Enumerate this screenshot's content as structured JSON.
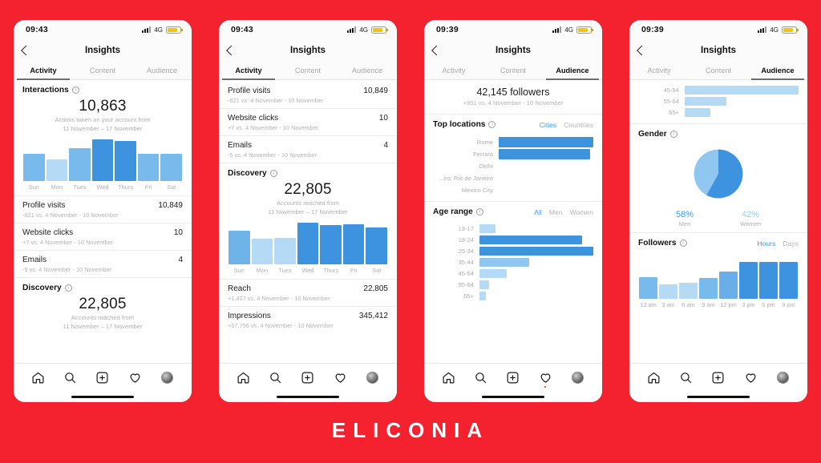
{
  "brand": {
    "name": "ELICONIA"
  },
  "theme": {
    "background_red": "#F4212E",
    "accent_blue": "#3D9BE9",
    "bar_dark": "#3E93DE",
    "bar_mid": "#79BAEC",
    "bar_light": "#B5DAF5"
  },
  "nav": {
    "title": "Insights",
    "back_icon": "chevron-left-icon"
  },
  "tabs": {
    "activity": "Activity",
    "content": "Content",
    "audience": "Audience"
  },
  "bottom_nav": {
    "home": "home-icon",
    "search": "search-icon",
    "create": "plus-square-icon",
    "activity": "heart-icon",
    "profile": "avatar-icon"
  },
  "phones": [
    {
      "id": "phone-1",
      "status": {
        "time": "09:43",
        "network": "4G",
        "signal_icon": "signal-bars-icon",
        "battery_icon": "battery-low-power-icon"
      },
      "active_tab": "Activity",
      "sections": {
        "interactions": {
          "title": "Interactions",
          "value": "10,863",
          "subtitle_line1": "Actions taken on your account from",
          "subtitle_line2": "11 November – 17 November"
        },
        "discovery": {
          "title": "Discovery",
          "value": "22,805",
          "subtitle_line1": "Accounts reached from",
          "subtitle_line2": "11 November – 17 November"
        }
      },
      "metrics": [
        {
          "label": "Profile visits",
          "value": "10,849",
          "sub": "-621 vs. 4 November - 10 November"
        },
        {
          "label": "Website clicks",
          "value": "10",
          "sub": "+7 vs. 4 November - 10 November"
        },
        {
          "label": "Emails",
          "value": "4",
          "sub": "-5 vs. 4 November - 10 November"
        }
      ]
    },
    {
      "id": "phone-2",
      "status": {
        "time": "09:43",
        "network": "4G",
        "signal_icon": "signal-bars-icon",
        "battery_icon": "battery-low-power-icon"
      },
      "active_tab": "Activity",
      "metrics_top": [
        {
          "label": "Profile visits",
          "value": "10,849",
          "sub": "-621 vs. 4 November - 10 November"
        },
        {
          "label": "Website clicks",
          "value": "10",
          "sub": "+7 vs. 4 November - 10 November"
        },
        {
          "label": "Emails",
          "value": "4",
          "sub": "-5 vs. 4 November - 10 November"
        }
      ],
      "sections": {
        "discovery": {
          "title": "Discovery",
          "value": "22,805",
          "subtitle_line1": "Accounts reached from",
          "subtitle_line2": "11 November – 17 November"
        }
      },
      "metrics_bottom": [
        {
          "label": "Reach",
          "value": "22,805",
          "sub": "+1,427 vs. 4 November - 10 November"
        },
        {
          "label": "Impressions",
          "value": "345,412",
          "sub": "+57,756 vs. 4 November - 10 November"
        }
      ]
    },
    {
      "id": "phone-3",
      "status": {
        "time": "09:39",
        "network": "4G",
        "signal_icon": "signal-bars-icon",
        "battery_icon": "battery-low-power-icon"
      },
      "active_tab": "Audience",
      "followers": {
        "count": "42,145 followers",
        "sub": "+801 vs. 4 November - 10 November"
      },
      "top_locations": {
        "title": "Top locations",
        "seg_on": "Cities",
        "seg_off": "Countries"
      },
      "age_range": {
        "title": "Age range",
        "seg_all": "All",
        "seg_men": "Men",
        "seg_women": "Women"
      }
    },
    {
      "id": "phone-4",
      "status": {
        "time": "09:39",
        "network": "4G",
        "signal_icon": "signal-bars-icon",
        "battery_icon": "battery-low-power-icon"
      },
      "active_tab": "Audience",
      "gender": {
        "title": "Gender",
        "men_pct": "58%",
        "men_label": "Men",
        "women_pct": "42%",
        "women_label": "Women"
      },
      "followers_chart": {
        "title": "Followers",
        "seg_on": "Hours",
        "seg_off": "Days"
      }
    }
  ],
  "chart_data": [
    {
      "type": "bar",
      "id": "interactions-weekday-bars",
      "title": "Interactions",
      "categories": [
        "Sun",
        "Mon",
        "Tues",
        "Wed",
        "Thurs",
        "Fri",
        "Sat"
      ],
      "values": [
        66,
        52,
        78,
        100,
        96,
        66,
        66
      ],
      "colors": [
        "#79BAEC",
        "#B5DAF5",
        "#79BAEC",
        "#3E93DE",
        "#3E93DE",
        "#79BAEC",
        "#79BAEC"
      ],
      "ylabel": "Interactions",
      "xlabel": "",
      "grid": false
    },
    {
      "type": "bar",
      "id": "discovery-weekday-bars",
      "title": "Discovery",
      "categories": [
        "Sun",
        "Mon",
        "Tues",
        "Wed",
        "Thurs",
        "Fri",
        "Sat"
      ],
      "values": [
        80,
        62,
        64,
        100,
        94,
        96,
        88
      ],
      "colors": [
        "#6FB4E8",
        "#B5DAF5",
        "#B5DAF5",
        "#3E93DE",
        "#3E93DE",
        "#3E93DE",
        "#3E93DE"
      ],
      "ylabel": "Discovery",
      "xlabel": "",
      "grid": false
    },
    {
      "type": "bar",
      "id": "top-locations-bars",
      "title": "Top locations",
      "orientation": "horizontal",
      "categories": [
        "Rome",
        "Ferrara",
        "Delhi",
        "...iro, Rio de Janeiro",
        "Mexico City"
      ],
      "values": [
        100,
        97,
        0,
        0,
        0
      ],
      "colors": [
        "#3E93DE",
        "#3E93DE",
        "#3E93DE",
        "#3E93DE",
        "#3E93DE"
      ],
      "grid": false
    },
    {
      "type": "bar",
      "id": "age-range-bars",
      "title": "Age range",
      "orientation": "horizontal",
      "categories": [
        "13-17",
        "18-24",
        "25-34",
        "35-44",
        "45-54",
        "55-64",
        "65+"
      ],
      "values": [
        13,
        82,
        91,
        40,
        22,
        8,
        5
      ],
      "colors": [
        "#B5DAF5",
        "#3E93DE",
        "#3E93DE",
        "#8FC7F0",
        "#B5DAF5",
        "#B5DAF5",
        "#B5DAF5"
      ],
      "grid": false
    },
    {
      "type": "bar",
      "id": "age-range-bars-continued",
      "title": "Age range (continued)",
      "orientation": "horizontal",
      "categories": [
        "45-54",
        "55-64",
        "65+"
      ],
      "values": [
        22,
        8,
        5
      ],
      "colors": [
        "#B5DAF5",
        "#B5DAF5",
        "#B5DAF5"
      ],
      "grid": false
    },
    {
      "type": "pie",
      "id": "gender-pie",
      "title": "Gender",
      "labels": [
        "Men",
        "Women"
      ],
      "values": [
        58,
        42
      ],
      "colors": [
        "#3E93DE",
        "#8FC7F0"
      ],
      "legend": "bottom"
    },
    {
      "type": "bar",
      "id": "followers-hours-bars",
      "title": "Followers",
      "categories": [
        "12 am",
        "3 am",
        "6 am",
        "9 am",
        "12 pm",
        "3 pm",
        "6 pm",
        "9 pm"
      ],
      "values": [
        50,
        34,
        38,
        48,
        64,
        86,
        86,
        86
      ],
      "colors": [
        "#79BAEC",
        "#B5DAF5",
        "#B5DAF5",
        "#79BAEC",
        "#68AEE8",
        "#3E93DE",
        "#3E93DE",
        "#3E93DE"
      ],
      "xlabel": "",
      "grid": false
    }
  ]
}
